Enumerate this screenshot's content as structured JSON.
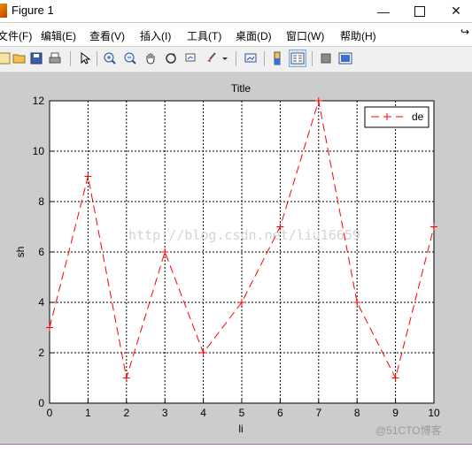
{
  "window": {
    "title": "Figure 1",
    "minimize_icon": "minimize-icon",
    "maximize_icon": "maximize-icon",
    "close_icon": "close-icon"
  },
  "menu": {
    "items": [
      "文件(F)",
      "编辑(E)",
      "查看(V)",
      "插入(I)",
      "工具(T)",
      "桌面(D)",
      "窗口(W)",
      "帮助(H)"
    ],
    "overflow_icon": "pin-icon"
  },
  "toolbar": {
    "icons": [
      "new-figure-icon",
      "open-file-icon",
      "save-icon",
      "print-icon",
      "arrow-pointer-icon",
      "zoom-in-icon",
      "zoom-out-icon",
      "pan-hand-icon",
      "rotate-3d-icon",
      "data-cursor-icon",
      "brush-icon",
      "link-plot-icon",
      "colorbar-icon",
      "legend-icon",
      "hide-plot-tools-icon",
      "show-plot-tools-icon"
    ]
  },
  "watermarks": {
    "center": "http://blog.csdn.net/liu16659",
    "corner": "@51CTO博客"
  },
  "colors": {
    "series": "#ff0000",
    "axes_bg": "#ffffff",
    "figure_bg": "#cccccc"
  },
  "chart_data": {
    "type": "line",
    "title": "Title",
    "xlabel": "li",
    "ylabel": "sh",
    "x": [
      0,
      1,
      2,
      3,
      4,
      5,
      6,
      7,
      8,
      9,
      10
    ],
    "xlim": [
      0,
      10
    ],
    "ylim": [
      0,
      12
    ],
    "xticks": [
      0,
      1,
      2,
      3,
      4,
      5,
      6,
      7,
      8,
      9,
      10
    ],
    "yticks": [
      0,
      2,
      4,
      6,
      8,
      10,
      12
    ],
    "grid": true,
    "grid_style": "dotted",
    "legend_position": "top-right",
    "series": [
      {
        "name": "de",
        "values": [
          3,
          9,
          1,
          6,
          2,
          4,
          7,
          12,
          4,
          1,
          7
        ],
        "color": "#ff0000",
        "line_style": "dashed",
        "marker": "+"
      }
    ]
  }
}
